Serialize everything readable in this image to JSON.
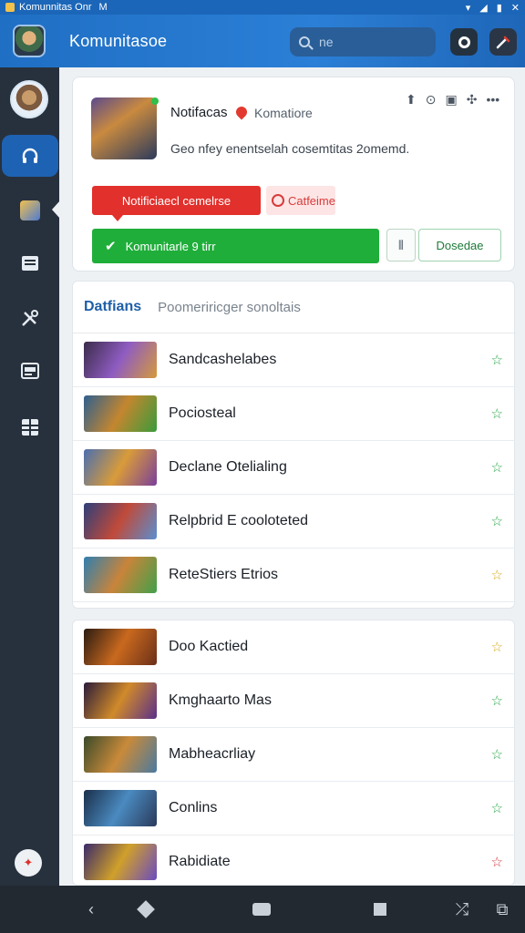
{
  "status_bar": {
    "title": "Komunnitas Onr",
    "extra": "M",
    "icons": [
      "wifi-icon",
      "signal-icon",
      "battery-icon",
      "close-icon"
    ]
  },
  "header": {
    "title": "Komunitasoe",
    "search_placeholder": "ne",
    "buttons": [
      "record-icon",
      "edit-icon"
    ]
  },
  "sidebar": {
    "items": [
      {
        "name": "sidebar-item-music",
        "icon": "headphones-icon",
        "active": true
      },
      {
        "name": "sidebar-item-game",
        "icon": "game-icon",
        "active": false
      },
      {
        "name": "sidebar-item-docs",
        "icon": "document-icon",
        "active": false
      },
      {
        "name": "sidebar-item-tools",
        "icon": "tools-icon",
        "active": false
      },
      {
        "name": "sidebar-item-media",
        "icon": "media-icon",
        "active": false
      },
      {
        "name": "sidebar-item-grid",
        "icon": "grid-icon",
        "active": false
      }
    ],
    "bottom_icon": "alert-icon"
  },
  "notification": {
    "title": "Notifacas",
    "subtitle": "Komatiore",
    "description": "Geo nfey enentselah cosemtitas 2omemd.",
    "tools": [
      "up-arrow-icon",
      "circle-dot-icon",
      "panel-icon",
      "settings-icon",
      "more-icon"
    ],
    "red_button": "Notificiaecl cemelrse",
    "pink_button": "Catfeime",
    "green_button": "Komunitarle 9 tirr",
    "outline_button": "Dosedae"
  },
  "tabs": {
    "active": "Datfians",
    "other": "Poomeriricger sonoltais"
  },
  "list1": [
    {
      "label": "Sandcashelabes",
      "star": "green",
      "thumb": [
        "#3b2c4a",
        "#8f5cc2",
        "#d49a3c"
      ]
    },
    {
      "label": "Pociosteal",
      "star": "green",
      "thumb": [
        "#2f5f8f",
        "#c4862f",
        "#3a9b3b"
      ]
    },
    {
      "label": "Declane Otelialing",
      "star": "green",
      "thumb": [
        "#4a6fb0",
        "#d99b3a",
        "#7a3f9a"
      ]
    },
    {
      "label": "Relpbrid E cooloteted",
      "star": "green",
      "thumb": [
        "#2d3f7a",
        "#c04a3a",
        "#5a8fd0"
      ]
    },
    {
      "label": "ReteStiers Etrios",
      "star": "yellow",
      "thumb": [
        "#2f7fb0",
        "#c9843a",
        "#42a04a"
      ]
    }
  ],
  "list2": [
    {
      "label": "Doo Kactied",
      "star": "yellow",
      "thumb": [
        "#2a1b12",
        "#c9691e",
        "#6b2f18"
      ]
    },
    {
      "label": "Kmghaarto Mas",
      "star": "green",
      "thumb": [
        "#2a1c3a",
        "#d08a2a",
        "#5a2f8a"
      ]
    },
    {
      "label": "Mabheacrliay",
      "star": "green",
      "thumb": [
        "#3a4a2a",
        "#c98a3a",
        "#4a7aa0"
      ]
    },
    {
      "label": "Conlins",
      "star": "green",
      "thumb": [
        "#1a2f4a",
        "#4a8ac0",
        "#2a3a5a"
      ]
    },
    {
      "label": "Rabidiate",
      "star": "red",
      "thumb": [
        "#3a2a6a",
        "#d0a02a",
        "#6a4ac0"
      ]
    }
  ],
  "navbar": {
    "icons": [
      "back-icon",
      "diamond-icon",
      "home-icon",
      "square-icon",
      "shuffle-icon",
      "exit-icon"
    ]
  }
}
